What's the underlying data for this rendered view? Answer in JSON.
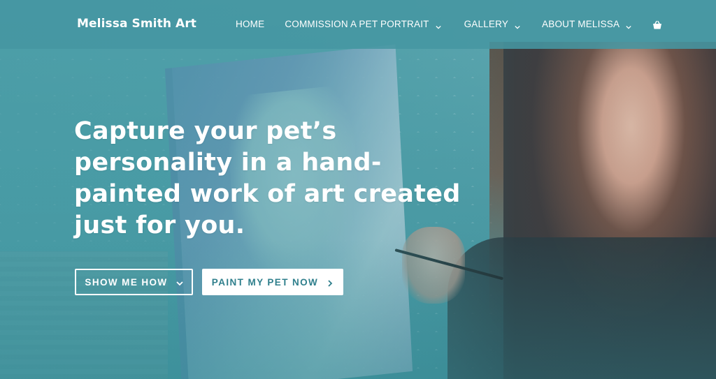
{
  "header": {
    "brand": "Melissa Smith Art",
    "nav": {
      "home": "HOME",
      "commission": "COMMISSION A PET PORTRAIT",
      "gallery": "GALLERY",
      "about": "ABOUT MELISSA"
    },
    "cart_icon": "shopping-basket-icon"
  },
  "hero": {
    "headline": "Capture your pet’s personality in a hand-painted work of art created just for you.",
    "buttons": {
      "show_me_how": "SHOW ME HOW",
      "paint_my_pet": "PAINT MY PET NOW"
    }
  },
  "colors": {
    "header_bg": "#4696a2",
    "accent_text": "#2f7f8c",
    "white": "#ffffff"
  }
}
